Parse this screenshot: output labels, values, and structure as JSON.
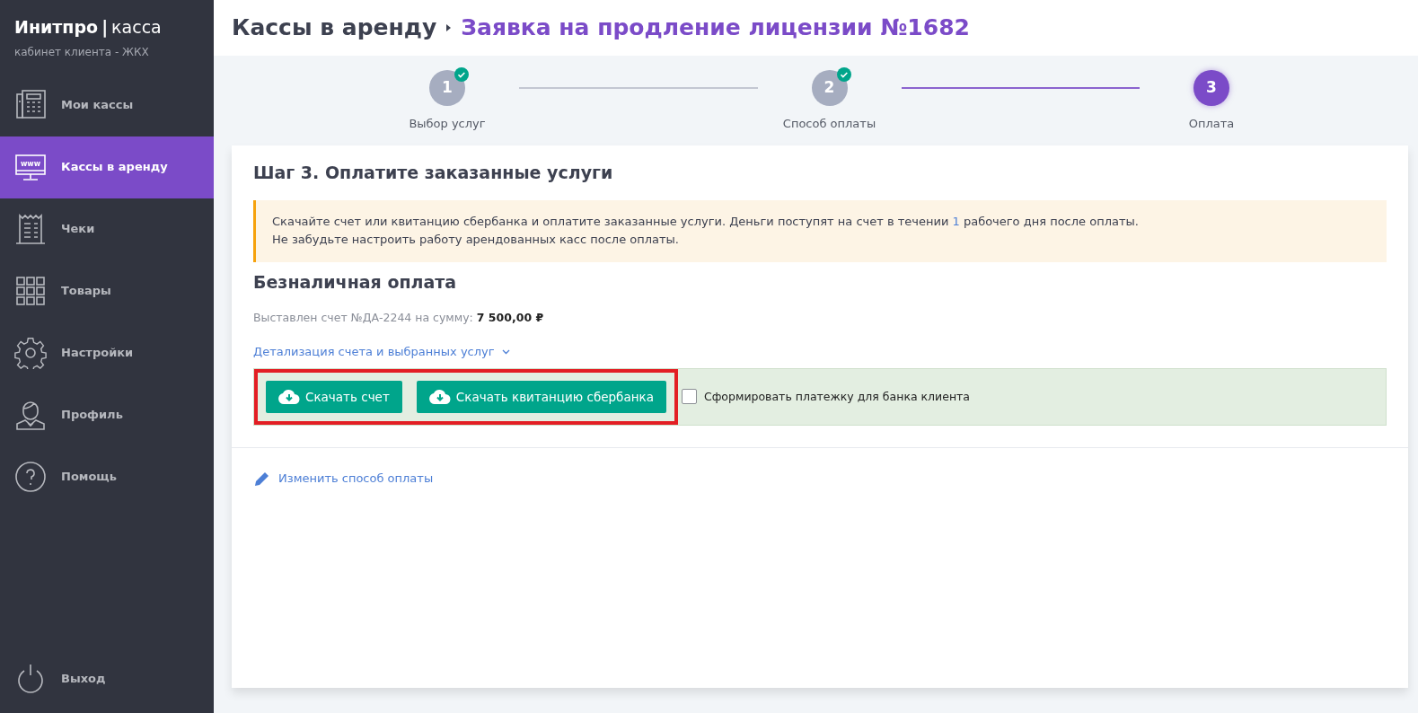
{
  "brand": {
    "name": "Инитпро",
    "product": "касса",
    "separator": "|",
    "subtitle": "кабинет клиента - ЖКХ"
  },
  "sidebar": {
    "items": [
      {
        "label": "Мои кассы",
        "selected": false
      },
      {
        "label": "Кассы в аренду",
        "selected": true,
        "icon_text": "www"
      },
      {
        "label": "Чеки",
        "selected": false
      },
      {
        "label": "Товары",
        "selected": false
      },
      {
        "label": "Настройки",
        "selected": false
      },
      {
        "label": "Профиль",
        "selected": false
      },
      {
        "label": "Помощь",
        "selected": false
      }
    ],
    "logout": "Выход"
  },
  "breadcrumb": {
    "parent": "Кассы в аренду",
    "current": "Заявка на продление лицензии №1682"
  },
  "steps": [
    {
      "number": "1",
      "label": "Выбор услуг",
      "done": true,
      "selected": false
    },
    {
      "number": "2",
      "label": "Способ оплаты",
      "done": true,
      "selected": false
    },
    {
      "number": "3",
      "label": "Оплата",
      "done": false,
      "selected": true
    }
  ],
  "heading": "Шаг 3. Оплатите заказанные услуги",
  "alert": {
    "before": "Скачайте счет или квитанцию сбербанка и оплатите заказанные услуги. Деньги поступят на счет в течении ",
    "highlight": "1",
    "after": " рабочего дня после оплаты.",
    "line2": "Не забудьте настроить работу арендованных касс после оплаты."
  },
  "payment": {
    "title": "Безналичная оплата",
    "invoice_text": "Выставлен счет №ДА-2244 на сумму:",
    "amount": "7 500,00 ₽",
    "details_link": "Детализация счета и выбранных услуг"
  },
  "buttons": [
    "Скачать счет",
    "Скачать квитанцию сбербанка"
  ],
  "highlighted": true,
  "client_bank": {
    "label": "Сформировать платежку для банка клиента",
    "checked": false
  },
  "change_link": "Изменить способ оплаты"
}
